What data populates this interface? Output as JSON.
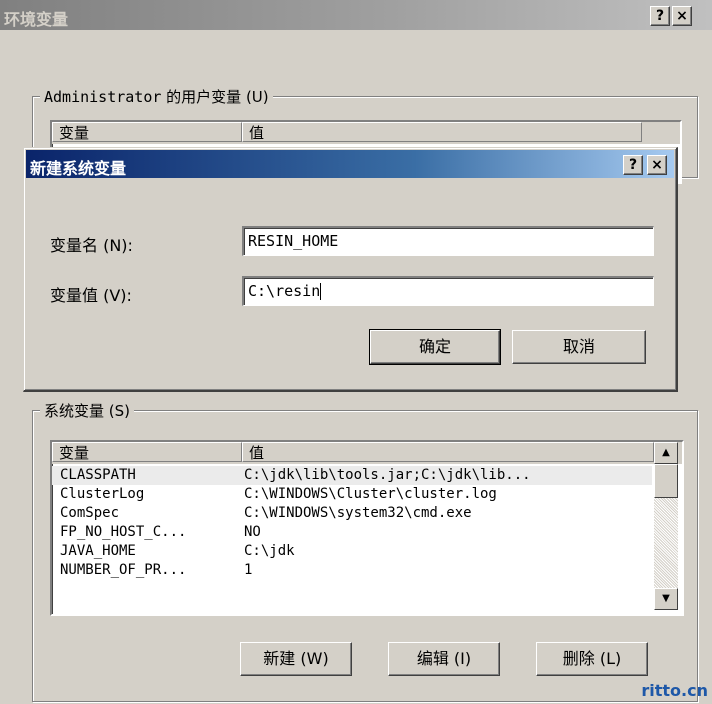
{
  "outer_dialog": {
    "title": "环境变量",
    "help_btn": "?",
    "close_btn": "×"
  },
  "user_vars": {
    "legend_prefix": "Administrator",
    "legend_suffix": " 的用户变量 (U)",
    "col_var": "变量",
    "col_val": "值"
  },
  "modal": {
    "title": "新建系统变量",
    "help_btn": "?",
    "close_btn": "×",
    "name_label": "变量名 (N):",
    "name_value": "RESIN_HOME",
    "value_label": "变量值 (V):",
    "value_value": "C:\\resin",
    "ok": "确定",
    "cancel": "取消"
  },
  "system_vars": {
    "legend": "系统变量 (S)",
    "col_var": "变量",
    "col_val": "值",
    "rows": [
      {
        "name": "CLASSPATH",
        "value": "C:\\jdk\\lib\\tools.jar;C:\\jdk\\lib..."
      },
      {
        "name": "ClusterLog",
        "value": "C:\\WINDOWS\\Cluster\\cluster.log"
      },
      {
        "name": "ComSpec",
        "value": "C:\\WINDOWS\\system32\\cmd.exe"
      },
      {
        "name": "FP_NO_HOST_C...",
        "value": "NO"
      },
      {
        "name": "JAVA_HOME",
        "value": "C:\\jdk"
      },
      {
        "name": "NUMBER_OF_PR...",
        "value": "1"
      }
    ],
    "btn_new": "新建 (W)",
    "btn_edit": "编辑 (I)",
    "btn_delete": "删除 (L)"
  },
  "scroll_up_icon": "up-arrow",
  "scroll_down_icon": "down-arrow",
  "watermark": "ritto.cn"
}
